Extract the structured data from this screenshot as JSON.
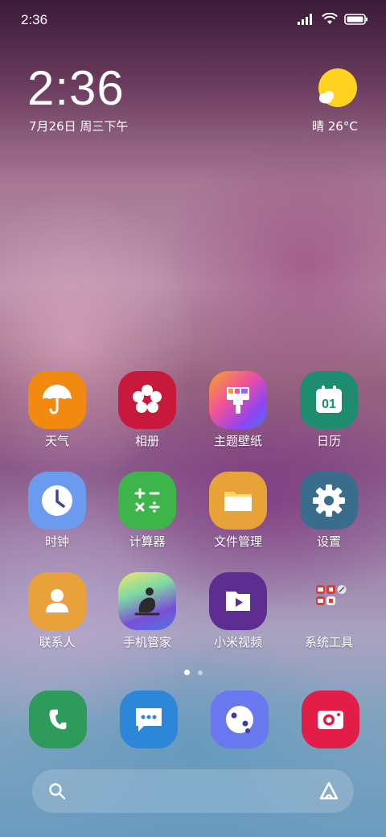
{
  "status_bar": {
    "time": "2:36"
  },
  "clock_widget": {
    "time": "2:36",
    "date": "7月26日 周三下午",
    "weather": "晴 26°C"
  },
  "apps": [
    {
      "label": "天气",
      "icon": "umbrella-icon",
      "color": "#F28A12"
    },
    {
      "label": "相册",
      "icon": "flower-icon",
      "color": "#C8193C"
    },
    {
      "label": "主题壁纸",
      "icon": "paintbrush-icon",
      "color": "#E84393"
    },
    {
      "label": "日历",
      "icon": "calendar-icon",
      "color": "#1E8C6E",
      "badge": "01"
    },
    {
      "label": "时钟",
      "icon": "clock-icon",
      "color": "#6B9BEF"
    },
    {
      "label": "计算器",
      "icon": "calculator-icon",
      "color": "#3DB54A"
    },
    {
      "label": "文件管理",
      "icon": "folder-icon",
      "color": "#E8A23A"
    },
    {
      "label": "设置",
      "icon": "gear-icon",
      "color": "#3A6D8C"
    },
    {
      "label": "联系人",
      "icon": "person-icon",
      "color": "#E9A13B"
    },
    {
      "label": "手机管家",
      "icon": "shield-person-icon",
      "color": "#7A4FD6"
    },
    {
      "label": "小米视频",
      "icon": "video-icon",
      "color": "#5E2D91"
    },
    {
      "label": "系统工具",
      "icon": "folder-grid-icon",
      "color": "#F2F2F2"
    }
  ],
  "dock": [
    {
      "name": "phone",
      "icon": "phone-icon",
      "color": "#2E9B5C"
    },
    {
      "name": "messages",
      "icon": "message-icon",
      "color": "#2E86D9"
    },
    {
      "name": "browser",
      "icon": "browser-icon",
      "color": "#6A78F0"
    },
    {
      "name": "camera",
      "icon": "camera-icon",
      "color": "#E11D48"
    }
  ],
  "page_indicator": {
    "pages": 2,
    "active": 1
  }
}
